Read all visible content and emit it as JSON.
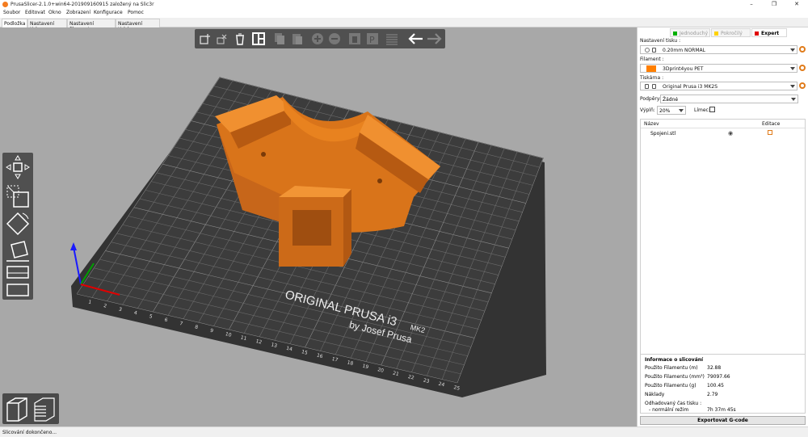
{
  "window": {
    "title": "PrusaSlicer-2.1.0+win64-201909160915 založený na Slic3r",
    "controls": [
      "–",
      "❐",
      "✕"
    ]
  },
  "menu": [
    "Soubor",
    "Editovat",
    "Okno",
    "Zobrazení",
    "Konfigurace",
    "Pomoc"
  ],
  "tabs": [
    "Podložka",
    "Nastavení tisku",
    "Nastavení filamentu",
    "Nastavení tiskárny"
  ],
  "active_tab": "Podložka",
  "viewport": {
    "bed_text_line1": "ORIGINAL PRUSA i3",
    "bed_text_mk": "MK2",
    "bed_text_line2": "by Josef Prusa",
    "axis_numbers": [
      "1",
      "2",
      "3",
      "4",
      "5",
      "6",
      "7",
      "8",
      "9",
      "10",
      "11",
      "12",
      "13",
      "14",
      "15",
      "16",
      "17",
      "18",
      "19",
      "20",
      "21",
      "22",
      "23",
      "24",
      "25"
    ],
    "model_color": "#e8821f",
    "bed_color": "#3c3c3c"
  },
  "top_toolbar": {
    "items": [
      "add-icon",
      "delete-icon",
      "delete-all-icon",
      "arrange-icon",
      "copy-icon",
      "paste-icon",
      "add-instance-icon",
      "remove-instance-icon",
      "split-objects-icon",
      "split-parts-icon",
      "layers-editing-icon",
      "undo-icon",
      "redo-icon"
    ]
  },
  "left_toolbar": {
    "items": [
      "move-icon",
      "scale-icon",
      "rotate-icon",
      "place-on-face-icon",
      "cut-icon",
      "support-points-icon"
    ]
  },
  "view_toggle": [
    "3d-view-icon",
    "preview-icon"
  ],
  "panel": {
    "modes": [
      {
        "label": "Jednoduchý",
        "color": "#00b000",
        "active": false
      },
      {
        "label": "Pokročilý",
        "color": "#ffd200",
        "active": false
      },
      {
        "label": "Expert",
        "color": "#e00000",
        "active": true
      }
    ],
    "print_settings_label": "Nastavení tisku :",
    "print_settings_value": "0.20mm NORMAL",
    "filament_label": "Filament :",
    "filament_value": "3Dprint4you PET",
    "filament_color": "#ff7f00",
    "printer_label": "Tiskárna :",
    "printer_value": "Original Prusa i3 MK2S",
    "supports_label": "Podpěry:",
    "supports_value": "Žádné",
    "infill_label": "Výplň:",
    "infill_value": "20%",
    "brim_label": "Límec:",
    "list_headers": {
      "name": "Název",
      "edit": "Editace"
    },
    "objects": [
      {
        "name": "Spojeni.stl"
      }
    ],
    "slice_info": {
      "title": "Informace o slicování",
      "rows": [
        {
          "label": "Použito Filamentu (m)",
          "value": "32.88"
        },
        {
          "label": "Použito Filamentu (mm³)",
          "value": "79097.66"
        },
        {
          "label": "Použito Filamentu (g)",
          "value": "100.45"
        },
        {
          "label": "Náklady",
          "value": "2.79"
        },
        {
          "label": "Odhadovaný čas tisku :",
          "value": ""
        },
        {
          "label": "- normální režim",
          "value": "7h 37m 45s"
        }
      ]
    },
    "export_button": "Exportovat G-code"
  },
  "status": "Slicování dokončeno..."
}
